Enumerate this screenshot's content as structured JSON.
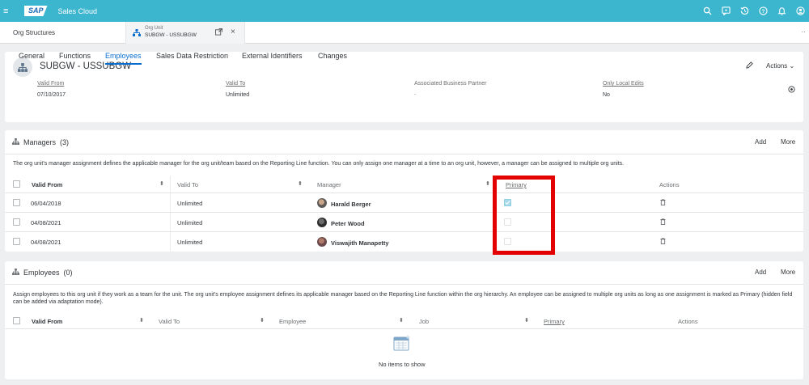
{
  "shell": {
    "title": "Sales Cloud",
    "logo": "SAP",
    "icons": [
      "search-icon",
      "feedback-icon",
      "history-icon",
      "help-icon",
      "notification-icon",
      "user-icon"
    ]
  },
  "tabs": {
    "first": "Org Structures",
    "active_sub": "Org Unit",
    "active_title": "SUBGW - USSUBGW",
    "more": "··"
  },
  "header": {
    "title": "SUBGW - USSUBGW",
    "actions_label": "Actions",
    "fields": [
      {
        "label": "Valid From",
        "value": "07/10/2017"
      },
      {
        "label": "Valid To",
        "value": "Unlimited"
      },
      {
        "label": "Associated Business Partner",
        "value": "-"
      },
      {
        "label": "Only Local Edits",
        "value": "No"
      }
    ],
    "tabs": [
      "General",
      "Functions",
      "Employees",
      "Sales Data Restriction",
      "External Identifiers",
      "Changes"
    ],
    "selected_tab": "Employees"
  },
  "managers": {
    "title": "Managers",
    "count": "(3)",
    "add": "Add",
    "more": "More",
    "description": "The org unit's manager assignment defines the applicable manager for the org unit/team based on the Reporting Line function. You can only assign one manager at a time to an org unit, however, a manager can be assigned to multiple org units.",
    "columns": [
      "Valid From",
      "Valid To",
      "Manager",
      "Primary",
      "Actions"
    ],
    "rows": [
      {
        "valid_from": "06/04/2018",
        "valid_to": "Unlimited",
        "manager": "Harald Berger",
        "primary": true
      },
      {
        "valid_from": "04/08/2021",
        "valid_to": "Unlimited",
        "manager": "Peter Wood",
        "primary": false
      },
      {
        "valid_from": "04/08/2021",
        "valid_to": "Unlimited",
        "manager": "Viswajith Manapetty",
        "primary": false
      }
    ]
  },
  "employees": {
    "title": "Employees",
    "count": "(0)",
    "add": "Add",
    "more": "More",
    "description": "Assign employees to this org unit if they work as a team for the unit. The org unit's employee assignment defines its applicable manager based on the Reporting Line function within the org hierarchy. An employee can be assigned to multiple org units as long as one assignment is marked as Primary (hidden field can be added via adaptation mode).",
    "columns": [
      "Valid From",
      "Valid To",
      "Employee",
      "Job",
      "Primary",
      "Actions"
    ],
    "empty_text": "No items to show"
  },
  "colors": {
    "shell": "#3cb5cf",
    "accent": "#0a6ed1",
    "highlight": "#e30000"
  }
}
